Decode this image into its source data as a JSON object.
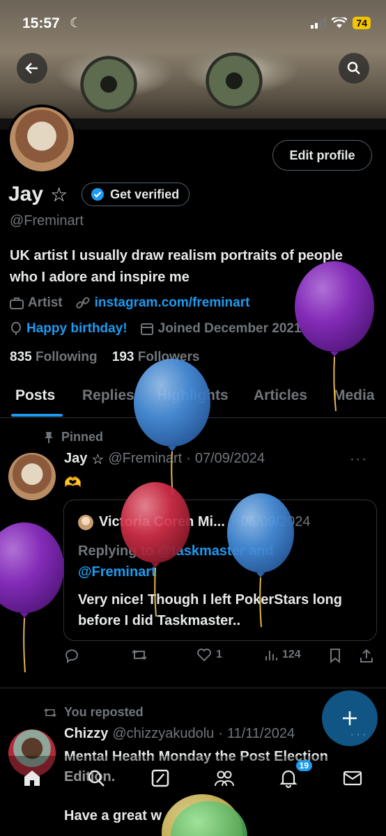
{
  "status": {
    "time": "15:57",
    "battery": "74"
  },
  "profile": {
    "edit_label": "Edit profile",
    "name": "Jay",
    "verify_label": "Get verified",
    "handle": "@Freminart",
    "bio": "UK artist I usually draw realism portraits of people who I adore and inspire me",
    "occupation": "Artist",
    "website": "instagram.com/freminart",
    "birthday": "Happy birthday!",
    "joined": "Joined December 2021",
    "following_count": "835",
    "following_label": "Following",
    "followers_count": "193",
    "followers_label": "Followers"
  },
  "tabs": [
    "Posts",
    "Replies",
    "Highlights",
    "Articles",
    "Media"
  ],
  "pinned_post": {
    "pinned_label": "Pinned",
    "author": "Jay",
    "handle": "@Freminart",
    "date": "07/09/2024",
    "emoji": "🫶",
    "quote": {
      "author": "Victoria Coren Mi...",
      "date": "06/09/2024",
      "replying_prefix": "Replying to",
      "replying_1": "@taskmaster and",
      "replying_2": "@Freminart",
      "text": "Very nice! Though I left PokerStars long before I did Taskmaster.."
    },
    "likes": "1",
    "views": "124"
  },
  "second_post": {
    "reposted_label": "You reposted",
    "author": "Chizzy",
    "handle": "@chizzyakudolu",
    "date": "11/11/2024",
    "text": "Mental Health Monday the Post Election Edition.",
    "text2": "Have a great w"
  },
  "nav": {
    "notifications_badge": "19"
  },
  "colors": {
    "accent": "#1d9bf0",
    "purple_balloon": "#8e2fc7",
    "blue_balloon": "#4a92e0",
    "red_balloon": "#d53048"
  }
}
